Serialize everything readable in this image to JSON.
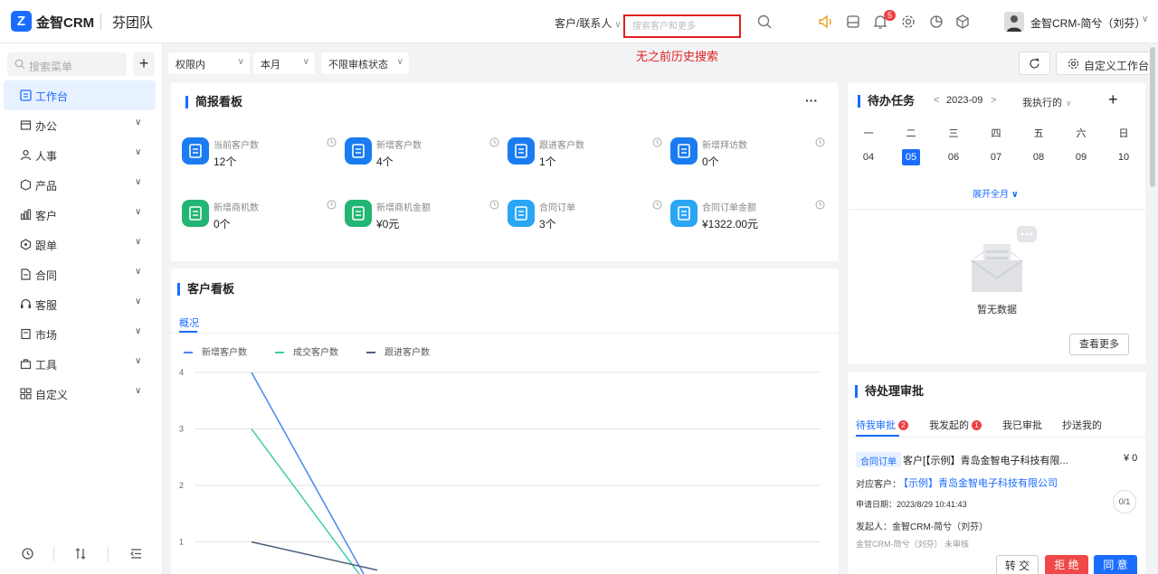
{
  "header": {
    "logo_letter": "Z",
    "brand": "金智CRM",
    "team": "芬团队",
    "scope": "客户/联系人",
    "search_placeholder": "搜索客户和更多",
    "annotation": "无之前历史搜索",
    "notification_count": "5",
    "user_name": "金智CRM-简兮（刘芬）"
  },
  "sidebar": {
    "search_placeholder": "搜索菜单",
    "add_label": "+",
    "items": [
      {
        "label": "工作台",
        "icon": "workbench-icon",
        "active": true
      },
      {
        "label": "办公",
        "icon": "office-icon"
      },
      {
        "label": "人事",
        "icon": "people-icon"
      },
      {
        "label": "产品",
        "icon": "product-icon"
      },
      {
        "label": "客户",
        "icon": "customer-icon"
      },
      {
        "label": "跟单",
        "icon": "follow-icon"
      },
      {
        "label": "合同",
        "icon": "contract-icon"
      },
      {
        "label": "客服",
        "icon": "service-icon"
      },
      {
        "label": "市场",
        "icon": "market-icon"
      },
      {
        "label": "工具",
        "icon": "tool-icon"
      },
      {
        "label": "自定义",
        "icon": "custom-icon"
      }
    ]
  },
  "filters": {
    "scope": "权限内",
    "period": "本月",
    "audit": "不限审核状态",
    "customize": "自定义工作台"
  },
  "brief": {
    "title": "简报看板",
    "more": "···",
    "stats": [
      {
        "label": "当前客户数",
        "value": "12个",
        "color": "#1a7cf0"
      },
      {
        "label": "新增客户数",
        "value": "4个",
        "color": "#1a7cf0"
      },
      {
        "label": "跟进客户数",
        "value": "1个",
        "color": "#1a7cf0"
      },
      {
        "label": "新增拜访数",
        "value": "0个",
        "color": "#1a7cf0"
      },
      {
        "label": "新增商机数",
        "value": "0个",
        "color": "#22b573"
      },
      {
        "label": "新增商机金额",
        "value": "¥0元",
        "color": "#22b573"
      },
      {
        "label": "合同订单",
        "value": "3个",
        "color": "#2aa6f5"
      },
      {
        "label": "合同订单金额",
        "value": "¥1322.00元",
        "color": "#2aa6f5"
      }
    ]
  },
  "customer_board": {
    "title": "客户看板",
    "tab": "概况"
  },
  "chart_data": {
    "type": "line",
    "title": "",
    "ylim": [
      0,
      4
    ],
    "y_ticks": [
      "4",
      "3",
      "2",
      "1"
    ],
    "series": [
      {
        "name": "新增客户数",
        "color": "#4a86f0",
        "values": [
          4,
          0
        ]
      },
      {
        "name": "成交客户数",
        "color": "#3dcfa6",
        "values": [
          3,
          0
        ]
      },
      {
        "name": "跟进客户数",
        "color": "#4b5f7c",
        "values": [
          1,
          0.5
        ]
      }
    ]
  },
  "todo": {
    "title": "待办任务",
    "month": "2023-09",
    "filter": "我执行的",
    "add": "+",
    "weekdays": [
      "一",
      "二",
      "三",
      "四",
      "五",
      "六",
      "日"
    ],
    "days": [
      "04",
      "05",
      "06",
      "07",
      "08",
      "09",
      "10"
    ],
    "selected_day": "05",
    "expand": "展开全月",
    "empty": "暂无数据",
    "more": "查看更多"
  },
  "approval": {
    "title": "待处理审批",
    "tabs": [
      {
        "label": "待我审批",
        "count": "2"
      },
      {
        "label": "我发起的",
        "count": "1"
      },
      {
        "label": "我已审批",
        "count": ""
      },
      {
        "label": "抄送我的",
        "count": ""
      }
    ],
    "item": {
      "tag": "合同订单",
      "name": "客户[【示例】青岛金智电子科技有限...",
      "amount": "¥ 0",
      "customer_label": "对应客户：",
      "customer": "【示例】青岛金智电子科技有限公司",
      "date": "申请日期：2023/8/29 10:41:43",
      "progress": "0/1",
      "initiator": "发起人：金智CRM-简兮（刘芬）",
      "status": "金智CRM-简兮（刘芬） 未审核"
    },
    "buttons": {
      "transfer": "转 交",
      "reject": "拒 绝",
      "approve": "同 意"
    }
  }
}
